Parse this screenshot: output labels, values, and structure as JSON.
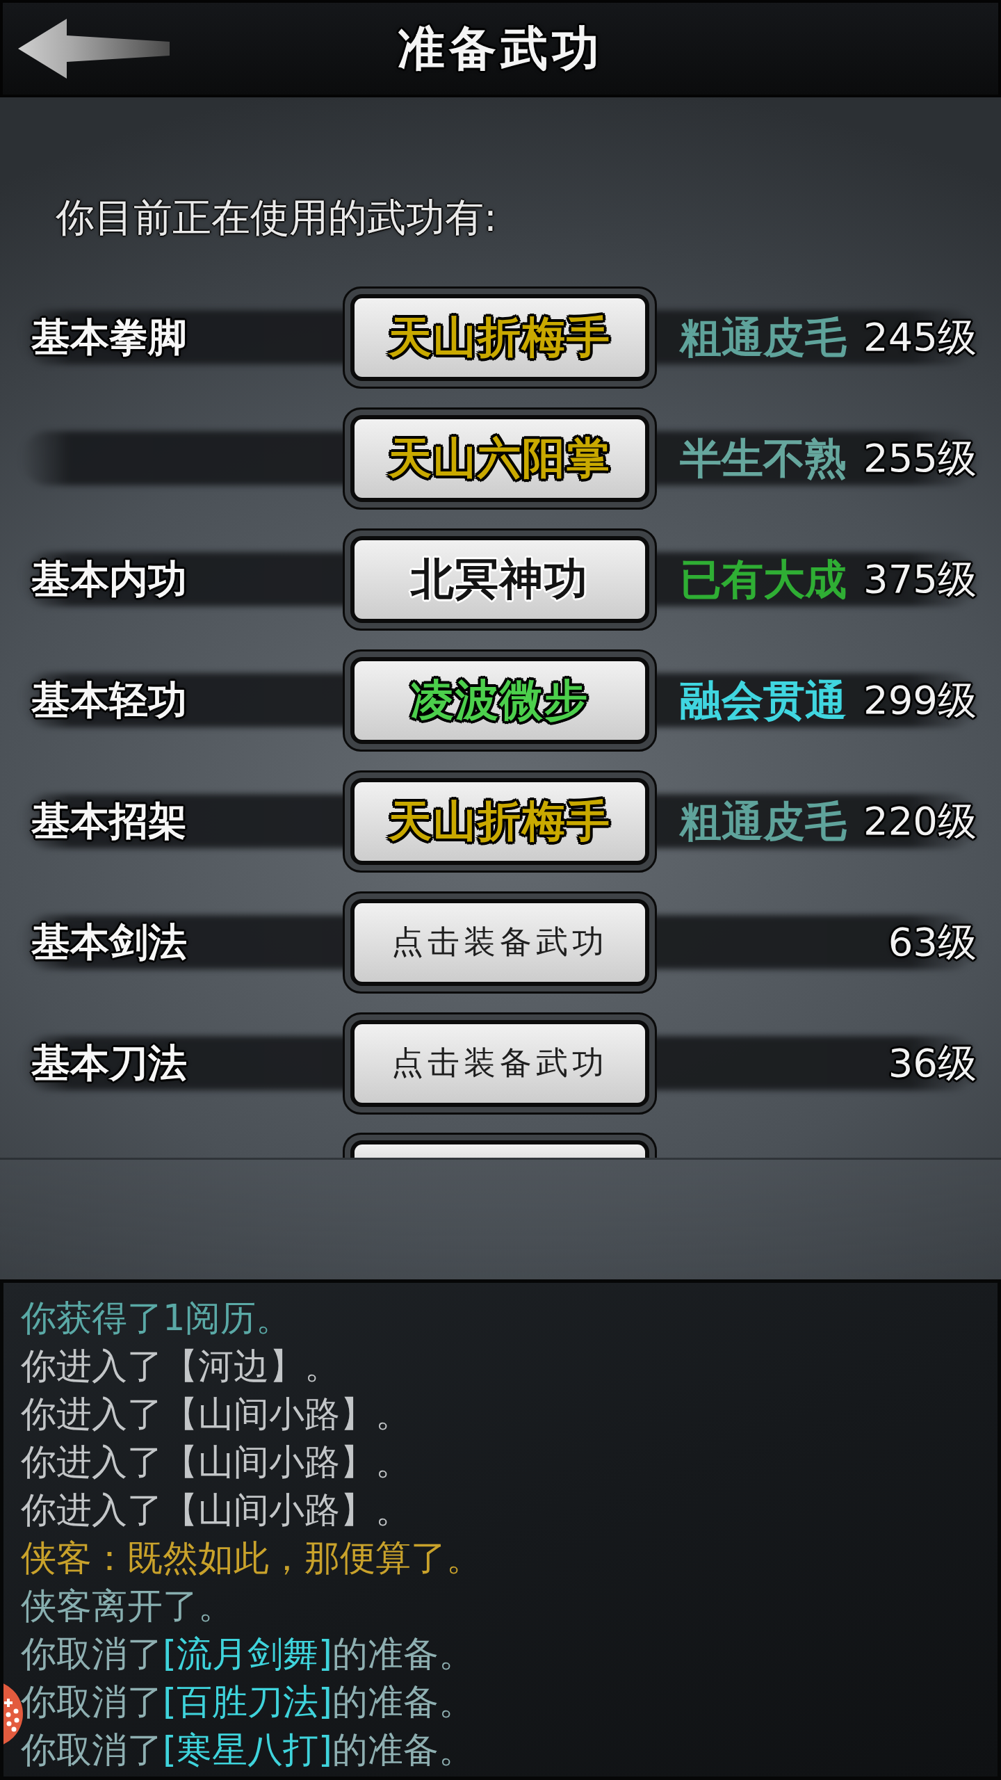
{
  "header": {
    "title": "准备武功"
  },
  "subtitle": "你目前正在使用的武功有:",
  "skills": {
    "rows": [
      {
        "label": "基本拳脚",
        "skill": {
          "kind": "equipped",
          "name": "天山折梅手",
          "color": "#c9a900"
        },
        "status": {
          "text": "粗通皮毛",
          "color": "#5fa39b"
        },
        "level": "245级"
      },
      {
        "skill": {
          "kind": "equipped",
          "name": "天山六阳掌",
          "color": "#c9a900"
        },
        "status": {
          "text": "半生不熟",
          "color": "#66a79e"
        },
        "level": "255级"
      },
      {
        "label": "基本内功",
        "skill": {
          "kind": "equipped",
          "name": "北冥神功",
          "color": "#141414"
        },
        "status": {
          "text": "已有大成",
          "color": "#2fae34"
        },
        "level": "375级"
      },
      {
        "label": "基本轻功",
        "skill": {
          "kind": "equipped",
          "name": "凌波微步",
          "color": "#4ccf4c"
        },
        "status": {
          "text": "融会贯通",
          "color": "#40d6e0"
        },
        "level": "299级"
      },
      {
        "label": "基本招架",
        "skill": {
          "kind": "equipped",
          "name": "天山折梅手",
          "color": "#c9a900"
        },
        "status": {
          "text": "粗通皮毛",
          "color": "#5fa39b"
        },
        "level": "220级"
      },
      {
        "label": "基本剑法",
        "skill": {
          "kind": "empty",
          "name": "点击装备武功"
        },
        "level": "63级"
      },
      {
        "label": "基本刀法",
        "skill": {
          "kind": "empty",
          "name": "点击装备武功"
        },
        "level": "36级"
      }
    ],
    "partial_row_below": true
  },
  "log": {
    "lines": [
      {
        "segments": [
          {
            "text": "你获得了1阅历。",
            "color": "#5aa9a6"
          }
        ]
      },
      {
        "segments": [
          {
            "text": "你进入了【河边】。",
            "color": "#c3c6c8"
          }
        ]
      },
      {
        "segments": [
          {
            "text": "你进入了【山间小路】。",
            "color": "#c3c6c8"
          }
        ]
      },
      {
        "segments": [
          {
            "text": "你进入了【山间小路】。",
            "color": "#c3c6c8"
          }
        ]
      },
      {
        "segments": [
          {
            "text": "你进入了【山间小路】。",
            "color": "#c3c6c8"
          }
        ]
      },
      {
        "segments": [
          {
            "text": "侠客：既然如此，那便算了。",
            "color": "#c9a22b"
          }
        ]
      },
      {
        "segments": [
          {
            "text": "侠客离开了。",
            "color": "#88afb0"
          }
        ]
      },
      {
        "segments": [
          {
            "text": "你取消了",
            "color": "#8fb0b2"
          },
          {
            "text": "[流月剑舞]",
            "color": "#3fd4dc"
          },
          {
            "text": "的准备。",
            "color": "#8fb0b2"
          }
        ]
      },
      {
        "segments": [
          {
            "text": "你取消了",
            "color": "#8fb0b2"
          },
          {
            "text": "[百胜刀法]",
            "color": "#3fd4dc"
          },
          {
            "text": "的准备。",
            "color": "#8fb0b2"
          }
        ]
      },
      {
        "segments": [
          {
            "text": "你取消了",
            "color": "#8fb0b2"
          },
          {
            "text": "[寒星八打]",
            "color": "#3fd4dc"
          },
          {
            "text": "的准备。",
            "color": "#8fb0b2"
          }
        ]
      }
    ]
  }
}
